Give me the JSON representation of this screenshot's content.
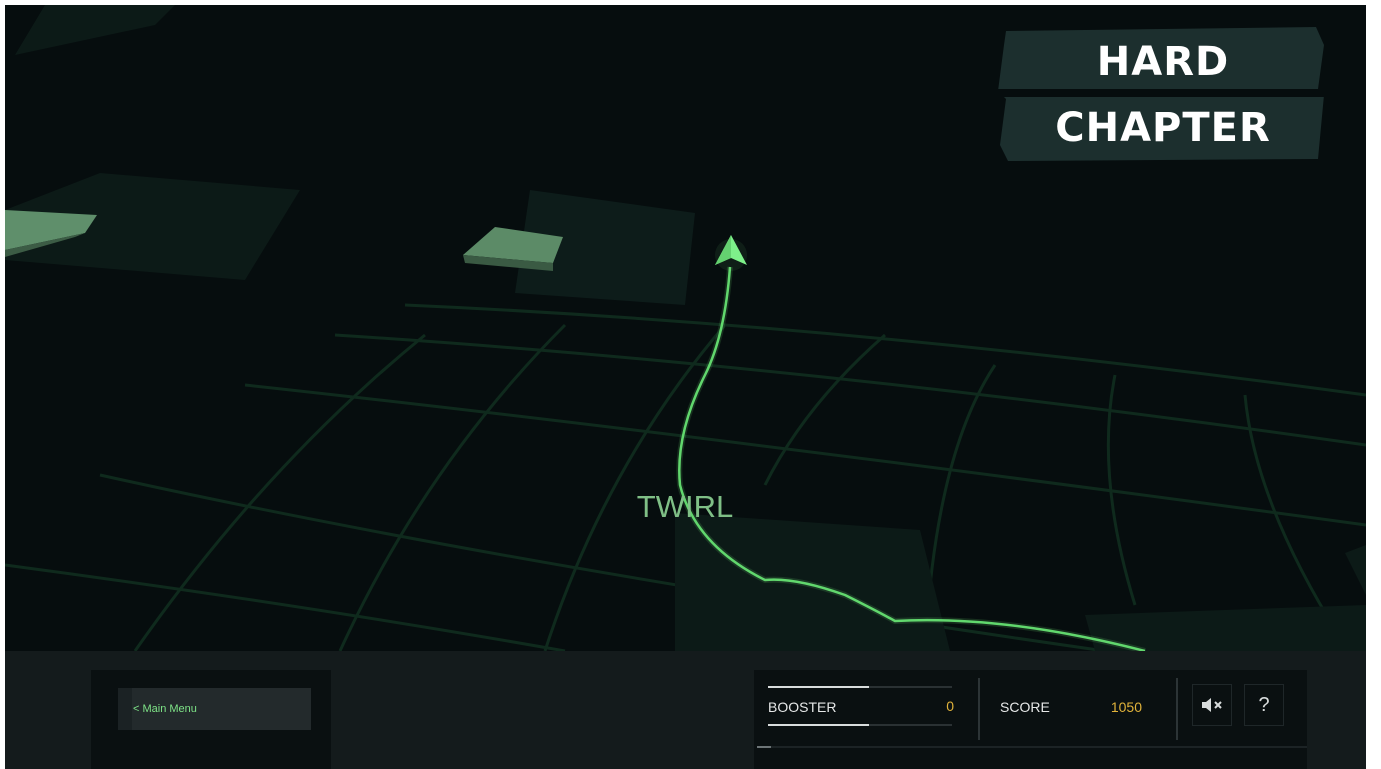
{
  "game": {
    "chapter_title_line1": "HARD",
    "chapter_title_line2": "CHAPTER",
    "level_name": "TWIRL"
  },
  "hud": {
    "main_menu_label": "< Main Menu",
    "booster": {
      "label": "BOOSTER",
      "value": "0",
      "meter_fraction": 0.55
    },
    "score": {
      "label": "SCORE",
      "value": "1050"
    },
    "mute_icon": "speaker-muted-icon",
    "help_label": "?",
    "level_progress_fraction": 0.025
  },
  "colors": {
    "background": "#060d0e",
    "trail": "#6fe87a",
    "plane": "#7ef08a",
    "accent_text": "#7ee387",
    "value_text": "#e0b23a",
    "badge": "#1c2f2e"
  }
}
